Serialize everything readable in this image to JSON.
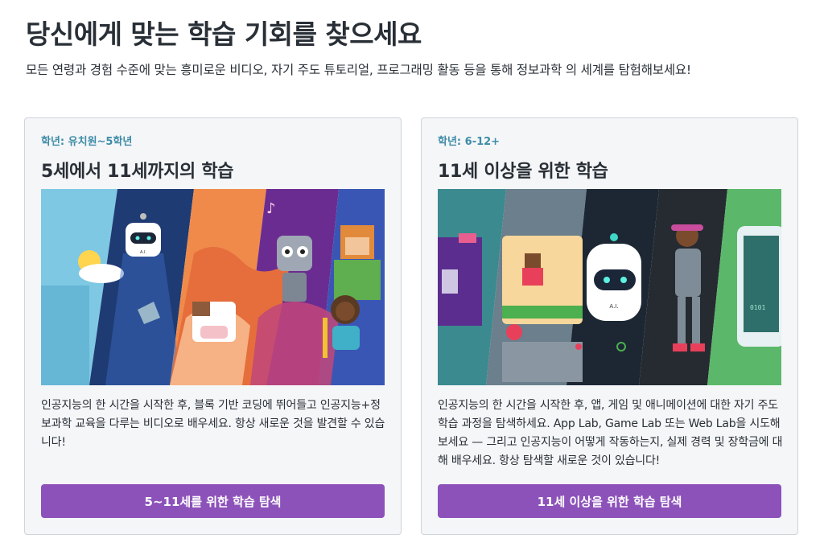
{
  "page": {
    "heading": "당신에게 맞는 학습 기회를 찾으세요",
    "subtitle": "모든 연령과 경험 수준에 맞는 흥미로운 비디오, 자기 주도 튜토리얼, 프로그래밍 활동 등을 통해 정보과학 의 세계를 탐험해보세요!"
  },
  "cards": [
    {
      "grade": "학년: 유치원~5학년",
      "title": "5세에서 11세까지의 학습",
      "image_label": "A.I.",
      "description": "인공지능의 한 시간을 시작한 후, 블록 기반 코딩에 뛰어들고 인공지능+정보과학 교육을 다루는 비디오로 배우세요. 항상 새로운 것을 발견할 수 있습니다!",
      "button": "5~11세를 위한 학습 탐색"
    },
    {
      "grade": "학년: 6-12+",
      "title": "11세 이상을 위한 학습",
      "image_label": "A.I.",
      "description": "인공지능의 한 시간을 시작한 후, 앱, 게임 및 애니메이션에 대한 자기 주도 학습 과정을 탐색하세요. App Lab, Game Lab 또는 Web Lab을 시도해 보세요 — 그리고 인공지능이 어떻게 작동하는지, 실제 경력 및 장학금에 대해 배우세요. 항상 탐색할 새로운 것이 있습니다!",
      "button": "11세 이상을 위한 학습 탐색"
    }
  ],
  "colors": {
    "heading": "#292f36",
    "grade": "#3e8ca7",
    "button": "#8c52ba",
    "card_bg": "#f4f6f8"
  }
}
